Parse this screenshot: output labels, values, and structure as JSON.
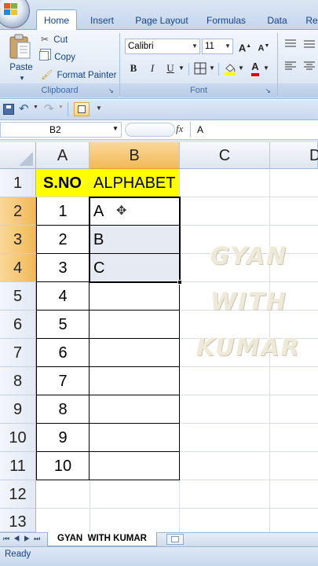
{
  "ribbon": {
    "tabs": [
      "Home",
      "Insert",
      "Page Layout",
      "Formulas",
      "Data",
      "Re"
    ],
    "clipboard": {
      "paste": "Paste",
      "cut": "Cut",
      "copy": "Copy",
      "format_painter": "Format Painter",
      "label": "Clipboard"
    },
    "font": {
      "name": "Calibri",
      "size": "11",
      "label": "Font",
      "bold": "B",
      "italic": "I",
      "underline": "U",
      "grow": "A",
      "shrink": "A",
      "font_color": "A"
    }
  },
  "formula_bar": {
    "name_box": "B2",
    "fx": "fx",
    "value": "A"
  },
  "grid": {
    "columns": [
      "A",
      "B",
      "C",
      "D"
    ],
    "row_numbers": [
      "1",
      "2",
      "3",
      "4",
      "5",
      "6",
      "7",
      "8",
      "9",
      "10",
      "11",
      "12",
      "13"
    ],
    "header_row": {
      "a": "S.NO",
      "b": "ALPHABET"
    },
    "rows": [
      {
        "a": "1",
        "b": "A"
      },
      {
        "a": "2",
        "b": "B"
      },
      {
        "a": "3",
        "b": "C"
      },
      {
        "a": "4",
        "b": ""
      },
      {
        "a": "5",
        "b": ""
      },
      {
        "a": "6",
        "b": ""
      },
      {
        "a": "7",
        "b": ""
      },
      {
        "a": "8",
        "b": ""
      },
      {
        "a": "9",
        "b": ""
      },
      {
        "a": "10",
        "b": ""
      }
    ]
  },
  "watermark": [
    "GYAN",
    "WITH",
    "KUMAR"
  ],
  "sheet_tab": "GYAN  WITH KUMAR",
  "status": "Ready",
  "colors": {
    "header_fill": "#ffff00",
    "selection_header": "#f5c26b",
    "ribbon_text": "#15428b"
  }
}
